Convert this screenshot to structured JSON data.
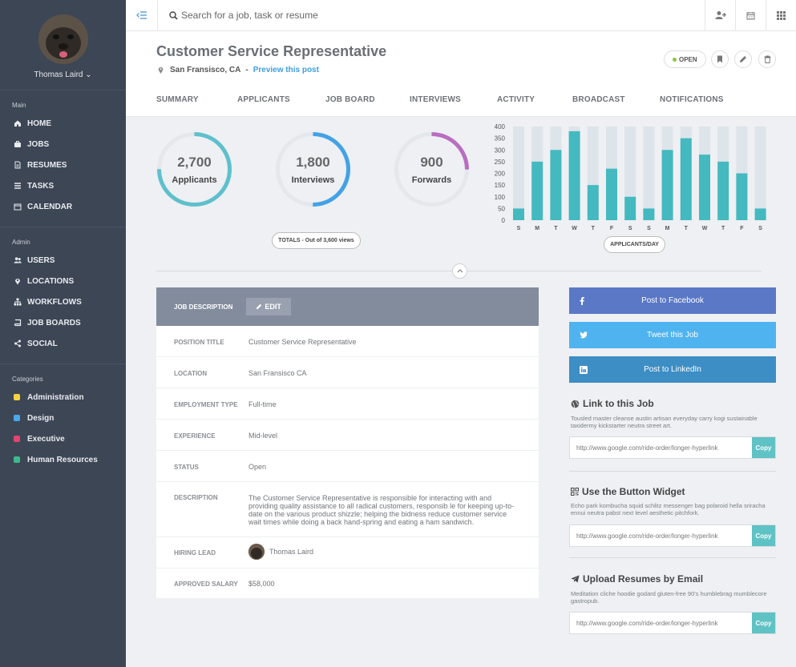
{
  "user": {
    "name": "Thomas Laird ⌄"
  },
  "sidebar": {
    "sections": [
      {
        "label": "Main",
        "items": [
          {
            "label": "HOME",
            "icon": "home-icon"
          },
          {
            "label": "JOBS",
            "icon": "briefcase-icon"
          },
          {
            "label": "RESUMES",
            "icon": "document-icon"
          },
          {
            "label": "TASKS",
            "icon": "list-icon"
          },
          {
            "label": "CALENDAR",
            "icon": "calendar-icon"
          }
        ]
      },
      {
        "label": "Admin",
        "items": [
          {
            "label": "USERS",
            "icon": "users-icon"
          },
          {
            "label": "LOCATIONS",
            "icon": "map-pin-icon"
          },
          {
            "label": "WORKFLOWS",
            "icon": "sitemap-icon"
          },
          {
            "label": "JOB BOARDS",
            "icon": "book-icon"
          },
          {
            "label": "SOCIAL",
            "icon": "share-icon"
          }
        ]
      }
    ],
    "categories": {
      "label": "Categories",
      "items": [
        {
          "label": "Administration",
          "color": "#f5d33f"
        },
        {
          "label": "Design",
          "color": "#4aa9e9"
        },
        {
          "label": "Executive",
          "color": "#e5436f"
        },
        {
          "label": "Human Resources",
          "color": "#3cba8b"
        }
      ]
    }
  },
  "topbar": {
    "search_placeholder": "Search for a job, task or resume"
  },
  "job": {
    "title": "Customer Service Representative",
    "location": "San Fransisco, CA",
    "separator": "-",
    "preview_label": "Preview this post",
    "status": "OPEN"
  },
  "tabs": [
    "SUMMARY",
    "APPLICANTS",
    "JOB BOARD",
    "INTERVIEWS",
    "ACTIVITY",
    "BROADCAST",
    "NOTIFICATIONS"
  ],
  "stats": [
    {
      "value": "2,700",
      "label": "Applicants",
      "fraction": 0.75,
      "color": "#5ec0cc"
    },
    {
      "value": "1,800",
      "label": "Interviews",
      "fraction": 0.5,
      "color": "#43a2e6"
    },
    {
      "value": "900",
      "label": "Forwards",
      "fraction": 0.25,
      "color": "#b96ec0"
    }
  ],
  "totals_label": "TOTALS - Out of 3,600 views",
  "chart_data": {
    "type": "bar",
    "categories": [
      "S",
      "M",
      "T",
      "W",
      "T",
      "F",
      "S",
      "S",
      "M",
      "T",
      "W",
      "T",
      "F",
      "S"
    ],
    "values": [
      50,
      250,
      300,
      380,
      150,
      220,
      100,
      50,
      300,
      350,
      280,
      250,
      200,
      50
    ],
    "ylim": [
      0,
      400
    ],
    "yticks": [
      0,
      50,
      100,
      150,
      200,
      250,
      300,
      350,
      400
    ],
    "bar_color": "#44b9c0",
    "track_color": "#dde4ea",
    "xlabel": "APPLICANTS/DAY"
  },
  "description": {
    "header": "JOB DESCRIPTION",
    "edit_label": "EDIT",
    "rows": [
      {
        "label": "POSITION TITLE",
        "value": "Customer Service Representative"
      },
      {
        "label": "LOCATION",
        "value": "San Fransisco CA"
      },
      {
        "label": "EMPLOYMENT TYPE",
        "value": "Full-time"
      },
      {
        "label": "EXPERIENCE",
        "value": "Mid-level"
      },
      {
        "label": "STATUS",
        "value": "Open"
      },
      {
        "label": "DESCRIPTION",
        "value": "The Customer Service Representative is responsible for interacting with and providing quality assistance to all radical customers, responsib le for keeping up-to-date on the various product shizzle; helping the bidness reduce customer service wait times while doing a back hand-spring and eating a ham sandwich."
      },
      {
        "label": "HIRING LEAD",
        "value": "Thomas Laird"
      },
      {
        "label": "APPROVED SALARY",
        "value": "$58,000"
      }
    ]
  },
  "share": [
    {
      "label": "Post to Facebook",
      "icon": "facebook-icon",
      "color": "#5a78c6"
    },
    {
      "label": "Tweet this Job",
      "icon": "twitter-icon",
      "color": "#4fb3ef"
    },
    {
      "label": "Post to LinkedIn",
      "icon": "linkedin-icon",
      "color": "#3d8ec4"
    }
  ],
  "widgets": [
    {
      "title": "Link to this Job",
      "icon": "globe-icon",
      "text": "Tousled master cleanse austin artisan everyday carry kogi sustainable taxidermy kickstarter neutra street art.",
      "url": "http://www.google.com/ride-order/longer-hyperlink",
      "copy": "Copy"
    },
    {
      "title": "Use the Button Widget",
      "icon": "qrcode-icon",
      "text": "Echo park kombucha squid schlitz messenger bag polaroid hella sriracha ennui neutra pabst next level aesthetic pitchfork.",
      "url": "http://www.google.com/ride-order/longer-hyperlink",
      "copy": "Copy"
    },
    {
      "title": "Upload Resumes by Email",
      "icon": "paper-plane-icon",
      "text": "Meditation cliche hoodie godard gluten-free 90's humblebrag mumblecore gastropub.",
      "url": "http://www.google.com/ride-order/longer-hyperlink",
      "copy": "Copy"
    }
  ]
}
